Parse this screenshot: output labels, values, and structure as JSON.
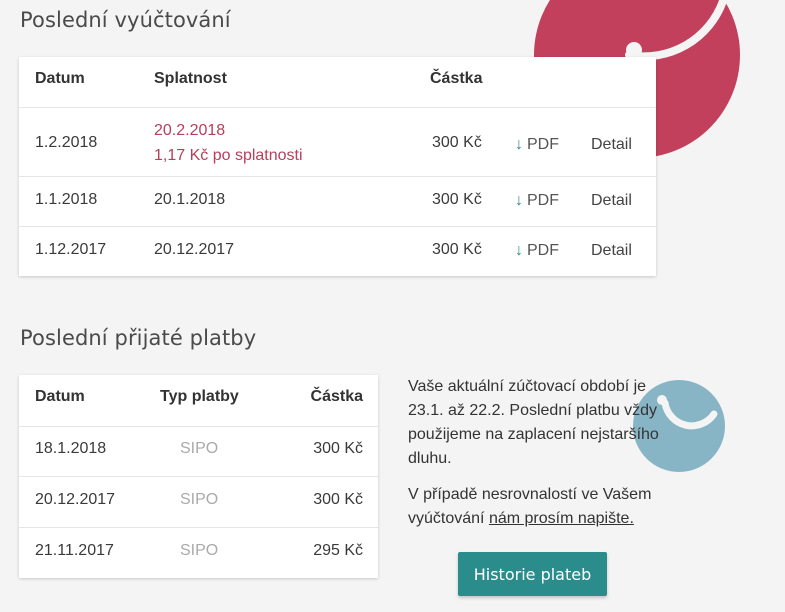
{
  "billing": {
    "title": "Poslední vyúčtování",
    "headers": {
      "date": "Datum",
      "due": "Splatnost",
      "amount": "Částka"
    },
    "rows": [
      {
        "date": "1.2.2018",
        "due": "20.2.2018",
        "due_note": "1,17 Kč po splatnosti",
        "amount": "300 Kč",
        "pdf": "PDF",
        "detail": "Detail"
      },
      {
        "date": "1.1.2018",
        "due": "20.1.2018",
        "amount": "300 Kč",
        "pdf": "PDF",
        "detail": "Detail"
      },
      {
        "date": "1.12.2017",
        "due": "20.12.2017",
        "amount": "300 Kč",
        "pdf": "PDF",
        "detail": "Detail"
      }
    ]
  },
  "payments": {
    "title": "Poslední přijaté platby",
    "headers": {
      "date": "Datum",
      "type": "Typ platby",
      "amount": "Částka"
    },
    "rows": [
      {
        "date": "18.1.2018",
        "type": "SIPO",
        "amount": "300 Kč"
      },
      {
        "date": "20.12.2017",
        "type": "SIPO",
        "amount": "300 Kč"
      },
      {
        "date": "21.11.2017",
        "type": "SIPO",
        "amount": "295 Kč"
      }
    ]
  },
  "info": {
    "paragraph1": "Vaše aktuální zúčtovací období je 23.1. až 22.2. Poslední platbu vždy použijeme na zaplacení nejstaršího dluhu.",
    "paragraph2_prefix": "V případě nesrovnalostí ve Vašem vyúčtování",
    "link": "nám prosím napište."
  },
  "history_button": "Historie plateb",
  "icons": {
    "download": "download-arrow-icon"
  },
  "colors": {
    "overdue": "#b83e5b",
    "accent": "#2b8d8b",
    "deco_red": "#c2405b",
    "deco_blue": "#87b5c6"
  }
}
